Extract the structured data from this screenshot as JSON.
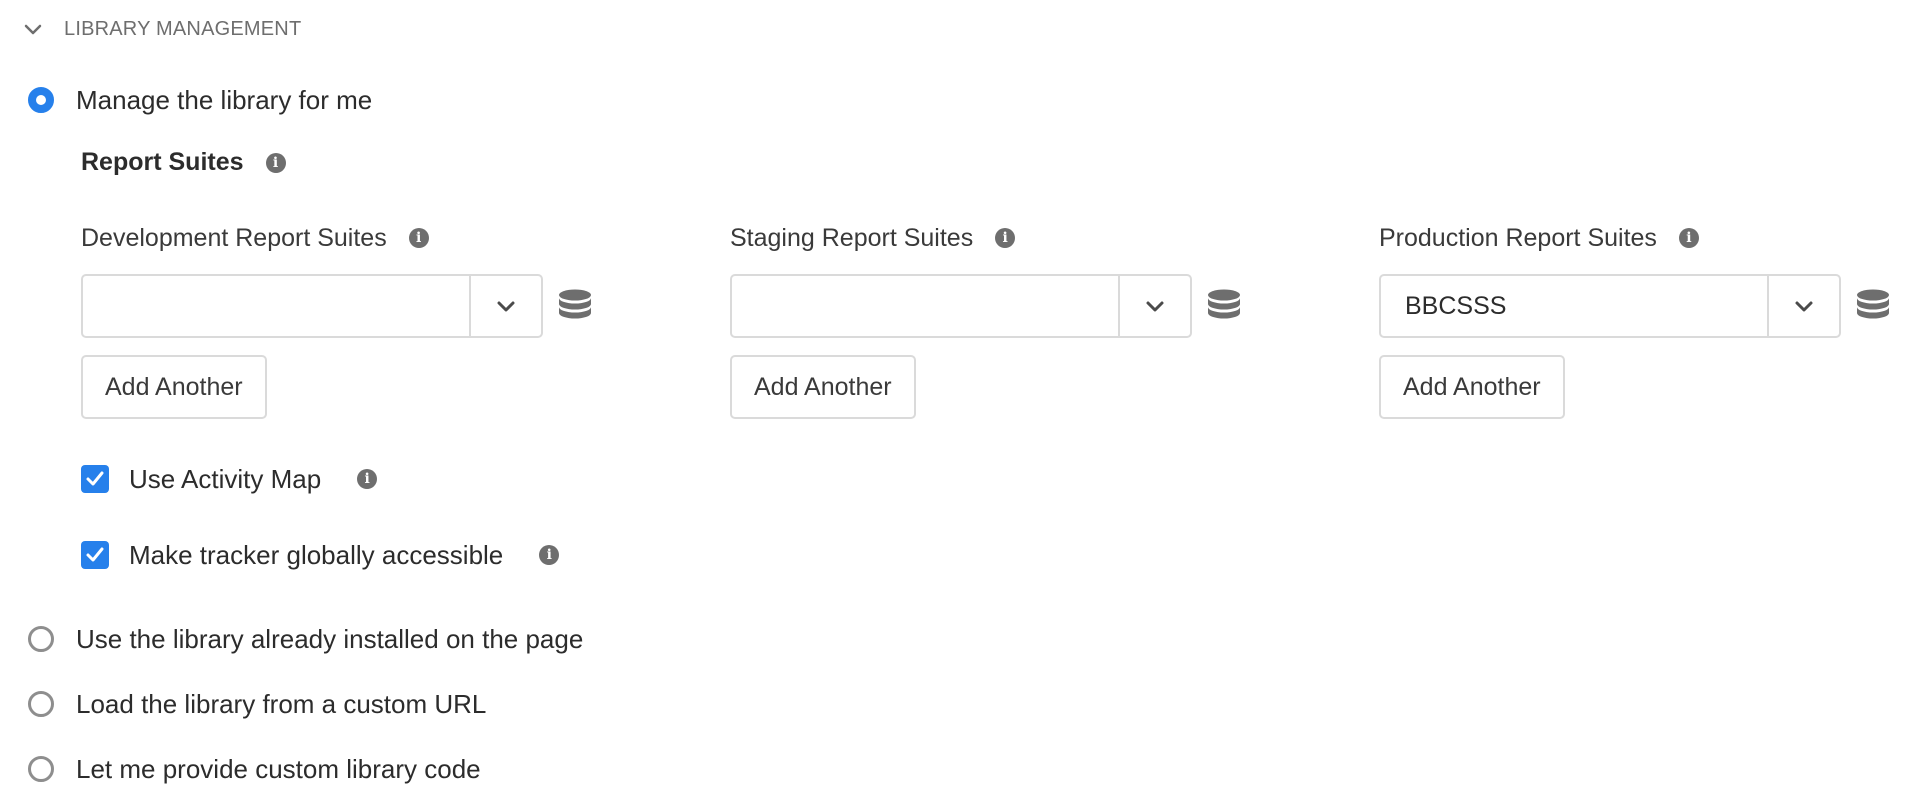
{
  "section": {
    "title": "LIBRARY MANAGEMENT"
  },
  "options": {
    "manage": "Manage the library for me",
    "installed": "Use the library already installed on the page",
    "custom_url": "Load the library from a custom URL",
    "custom_code": "Let me provide custom library code"
  },
  "report_suites": {
    "heading": "Report Suites",
    "development": {
      "label": "Development Report Suites",
      "value": "",
      "add": "Add Another"
    },
    "staging": {
      "label": "Staging Report Suites",
      "value": "",
      "add": "Add Another"
    },
    "production": {
      "label": "Production Report Suites",
      "value": "BBCSSS",
      "add": "Add Another"
    }
  },
  "checkboxes": {
    "activity_map": "Use Activity Map",
    "global_tracker": "Make tracker globally accessible"
  },
  "icons": {
    "info": "info-icon",
    "database": "database-icon",
    "chevron": "chevron-down-icon"
  },
  "colors": {
    "accent": "#2680eb",
    "icon_gray": "#6e6e6e"
  }
}
